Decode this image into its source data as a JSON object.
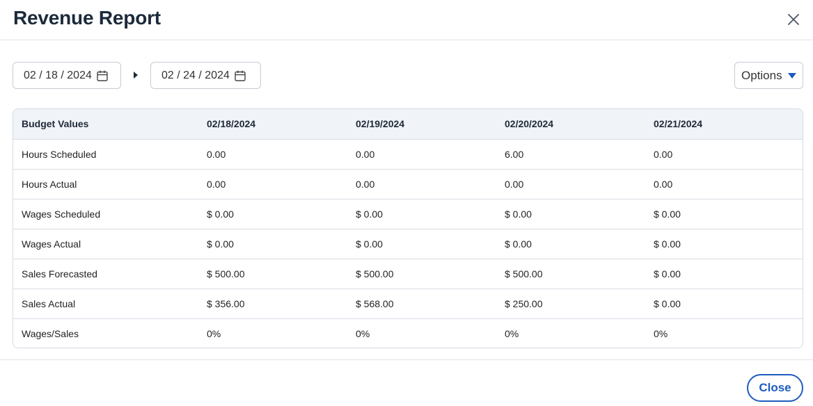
{
  "dialog": {
    "title": "Revenue Report",
    "close_icon": "close-icon",
    "close_button_label": "Close"
  },
  "date_range": {
    "start": "02 / 18 / 2024",
    "end": "02 / 24 / 2024",
    "calendar_icon": "calendar-icon",
    "separator_icon": "caret-right-icon"
  },
  "options": {
    "label": "Options",
    "caret_icon": "caret-down-icon",
    "caret_color": "#1d5bbf"
  },
  "table": {
    "headers": [
      "Budget Values",
      "02/18/2024",
      "02/19/2024",
      "02/20/2024",
      "02/21/2024"
    ],
    "rows": [
      [
        "Hours Scheduled",
        "0.00",
        "0.00",
        "6.00",
        "0.00"
      ],
      [
        "Hours Actual",
        "0.00",
        "0.00",
        "0.00",
        "0.00"
      ],
      [
        "Wages Scheduled",
        "$ 0.00",
        "$ 0.00",
        "$ 0.00",
        "$ 0.00"
      ],
      [
        "Wages Actual",
        "$ 0.00",
        "$ 0.00",
        "$ 0.00",
        "$ 0.00"
      ],
      [
        "Sales Forecasted",
        "$ 500.00",
        "$ 500.00",
        "$ 500.00",
        "$ 0.00"
      ],
      [
        "Sales Actual",
        "$ 356.00",
        "$ 568.00",
        "$ 250.00",
        "$ 0.00"
      ],
      [
        "Wages/Sales",
        "0%",
        "0%",
        "0%",
        "0%"
      ]
    ]
  },
  "colors": {
    "accent": "#1d5bbf",
    "header_row_bg": "#f0f3f8",
    "title": "#1c2a3a"
  }
}
